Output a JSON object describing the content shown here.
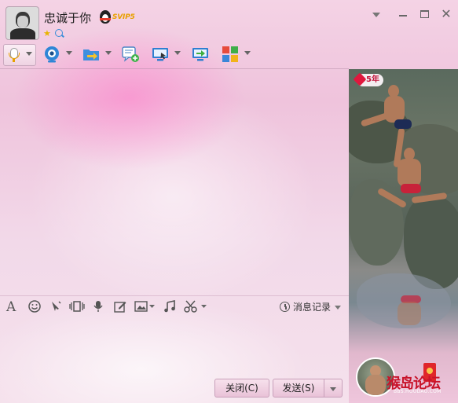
{
  "window": {
    "nickname": "忠诚于你",
    "badge_text": "SVIP5",
    "controls": [
      "dropdown",
      "minimize",
      "maximize",
      "close"
    ]
  },
  "toolbar": {
    "items": [
      {
        "name": "voice-call",
        "icon": "microphone-icon"
      },
      {
        "name": "video-call",
        "icon": "webcam-icon"
      },
      {
        "name": "send-file",
        "icon": "folder-transfer-icon"
      },
      {
        "name": "create-discussion",
        "icon": "chat-add-icon"
      },
      {
        "name": "remote-assist",
        "icon": "remote-desktop-icon"
      },
      {
        "name": "share-screen",
        "icon": "screen-share-icon"
      },
      {
        "name": "apps",
        "icon": "apps-grid-icon"
      }
    ]
  },
  "input_toolbar": {
    "items": [
      "font-icon",
      "emoji-icon",
      "poke-icon",
      "screen-shake-icon",
      "voice-message-icon",
      "doodle-icon",
      "image-icon",
      "music-icon",
      "screenshot-scissors-icon"
    ],
    "history_label": "消息记录"
  },
  "buttons": {
    "close_label": "关闭(C)",
    "send_label": "发送(S)"
  },
  "side_panel": {
    "year_badge": "5年",
    "watermark": "猴岛论坛",
    "watermark_url": "BBS.HOUDAO.COM"
  },
  "colors": {
    "accent_pink": "#efc3dc",
    "badge_red": "#c3143b",
    "svip_gold": "#e8a000"
  }
}
